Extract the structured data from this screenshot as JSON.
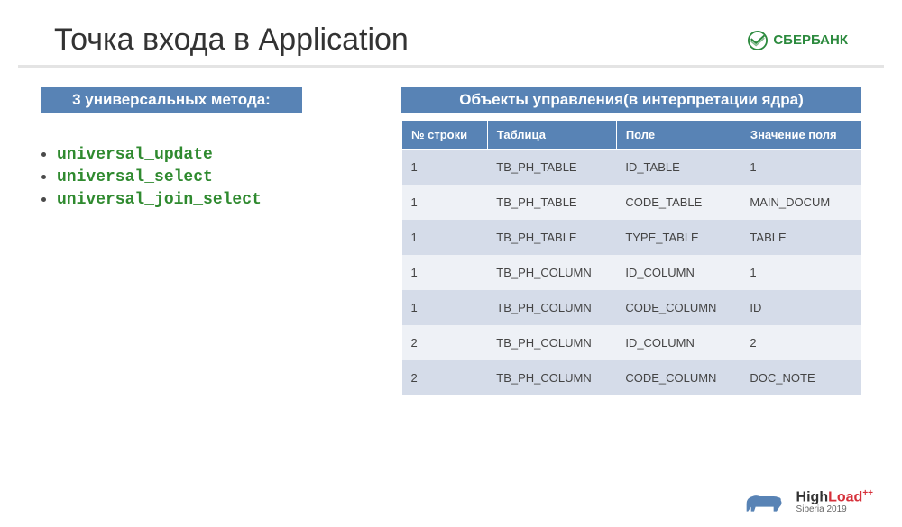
{
  "title": "Точка входа в Application",
  "brand": "СБЕРБАНК",
  "left_header": "3 универсальных метода:",
  "methods": [
    "universal_update",
    "universal_select",
    "universal_join_select"
  ],
  "right_header": "Объекты управления(в интерпретации ядра)",
  "table": {
    "headers": [
      "№ строки",
      "Таблица",
      "Поле",
      "Значение поля"
    ],
    "rows": [
      [
        "1",
        "TB_PH_TABLE",
        "ID_TABLE",
        "1"
      ],
      [
        "1",
        "TB_PH_TABLE",
        "CODE_TABLE",
        "MAIN_DOCUM"
      ],
      [
        "1",
        "TB_PH_TABLE",
        "TYPE_TABLE",
        "TABLE"
      ],
      [
        "1",
        "TB_PH_COLUMN",
        "ID_COLUMN",
        "1"
      ],
      [
        "1",
        "TB_PH_COLUMN",
        "CODE_COLUMN",
        "ID"
      ],
      [
        "2",
        "TB_PH_COLUMN",
        "ID_COLUMN",
        "2"
      ],
      [
        "2",
        "TB_PH_COLUMN",
        "CODE_COLUMN",
        "DOC_NOTE"
      ]
    ]
  },
  "footer": {
    "brand_high": "High",
    "brand_load": "Load",
    "brand_plus": "++",
    "sub": "Siberia 2019"
  }
}
